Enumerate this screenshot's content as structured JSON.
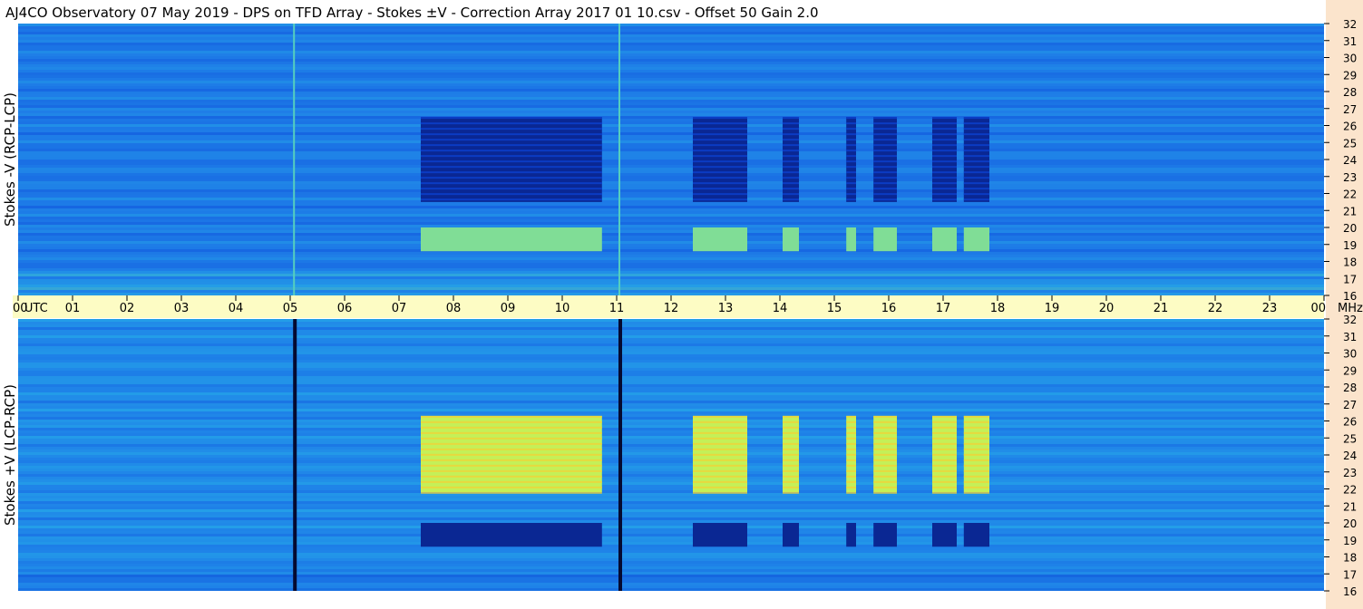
{
  "chart_data": {
    "type": "heatmap",
    "title": "AJ4CO Observatory  07 May 2019  -  DPS on TFD Array  -  Stokes ±V  -  Correction Array 2017 01 10.csv  -  Offset 50  Gain 2.0",
    "x_axis": {
      "unit_label": "UTC",
      "tick_labels": [
        "00",
        "01",
        "02",
        "03",
        "04",
        "05",
        "06",
        "07",
        "08",
        "09",
        "10",
        "11",
        "12",
        "13",
        "14",
        "15",
        "16",
        "17",
        "18",
        "19",
        "20",
        "21",
        "22",
        "23",
        "00"
      ],
      "xlim_hours": [
        0,
        24
      ]
    },
    "y_axis": {
      "unit_label": "MHz",
      "tick_labels": [
        "16",
        "17",
        "18",
        "19",
        "20",
        "21",
        "22",
        "23",
        "24",
        "25",
        "26",
        "27",
        "28",
        "29",
        "30",
        "31",
        "32"
      ],
      "ylim_mhz": [
        16,
        32
      ]
    },
    "panels": [
      {
        "ylabel": "Stokes -V (RCP-LCP)",
        "baseline_intensity": 0.32,
        "burst_intensity": 0.06,
        "burst_band_mhz": [
          21.5,
          26.5
        ],
        "low_band_mhz": [
          18.6,
          20.0
        ],
        "low_band_intensity": 0.6
      },
      {
        "ylabel": "Stokes +V (LCP-RCP)",
        "baseline_intensity": 0.36,
        "burst_intensity": 0.7,
        "burst_band_mhz": [
          21.8,
          26.3
        ],
        "low_band_mhz": [
          18.6,
          20.0
        ],
        "low_band_intensity": 0.06
      }
    ],
    "burst_intervals_utc_hours": [
      [
        7.4,
        10.73
      ],
      [
        12.4,
        13.4
      ],
      [
        14.05,
        14.35
      ],
      [
        15.22,
        15.4
      ],
      [
        15.72,
        16.15
      ],
      [
        16.8,
        17.25
      ],
      [
        17.38,
        17.85
      ]
    ],
    "interference_lines_utc_hours": [
      5.07,
      11.05
    ],
    "colormap": [
      "#0a1a6e",
      "#0a3fd6",
      "#1f7fe8",
      "#2bc0e6",
      "#b8f060",
      "#f2f23a",
      "#ff9a28"
    ]
  }
}
